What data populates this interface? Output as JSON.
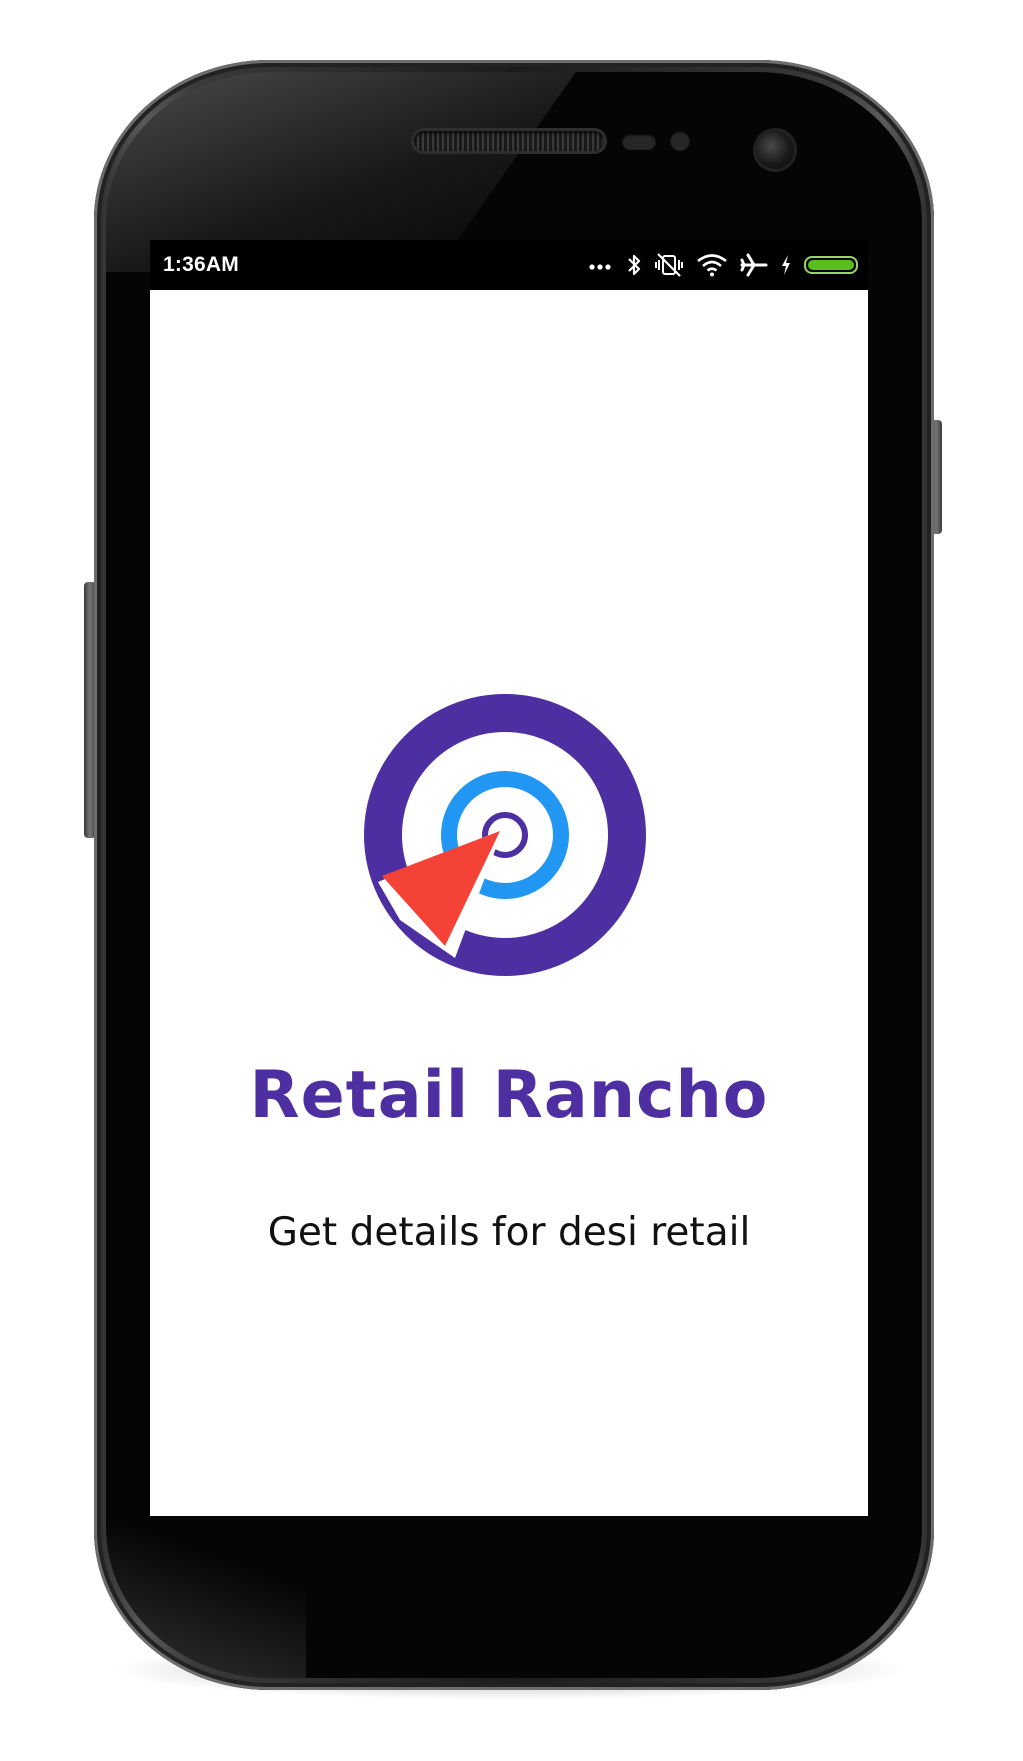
{
  "status_bar": {
    "time": "1:36AM",
    "icons": [
      "more-dots-icon",
      "bluetooth-icon",
      "vibrate-off-icon",
      "wifi-icon",
      "airplane-icon",
      "charging-icon",
      "battery-icon"
    ],
    "battery_level": 1.0,
    "battery_color": "#55c11a"
  },
  "splash": {
    "logo": {
      "name": "retail-rancho-logo",
      "colors": {
        "outer_ring": "#4d2fa1",
        "inner_ring": "#2196f3",
        "center_ring": "#4d2fa1",
        "pointer": "#f44336"
      }
    },
    "app_name": "Retail Rancho",
    "tagline": "Get details for desi retail"
  }
}
